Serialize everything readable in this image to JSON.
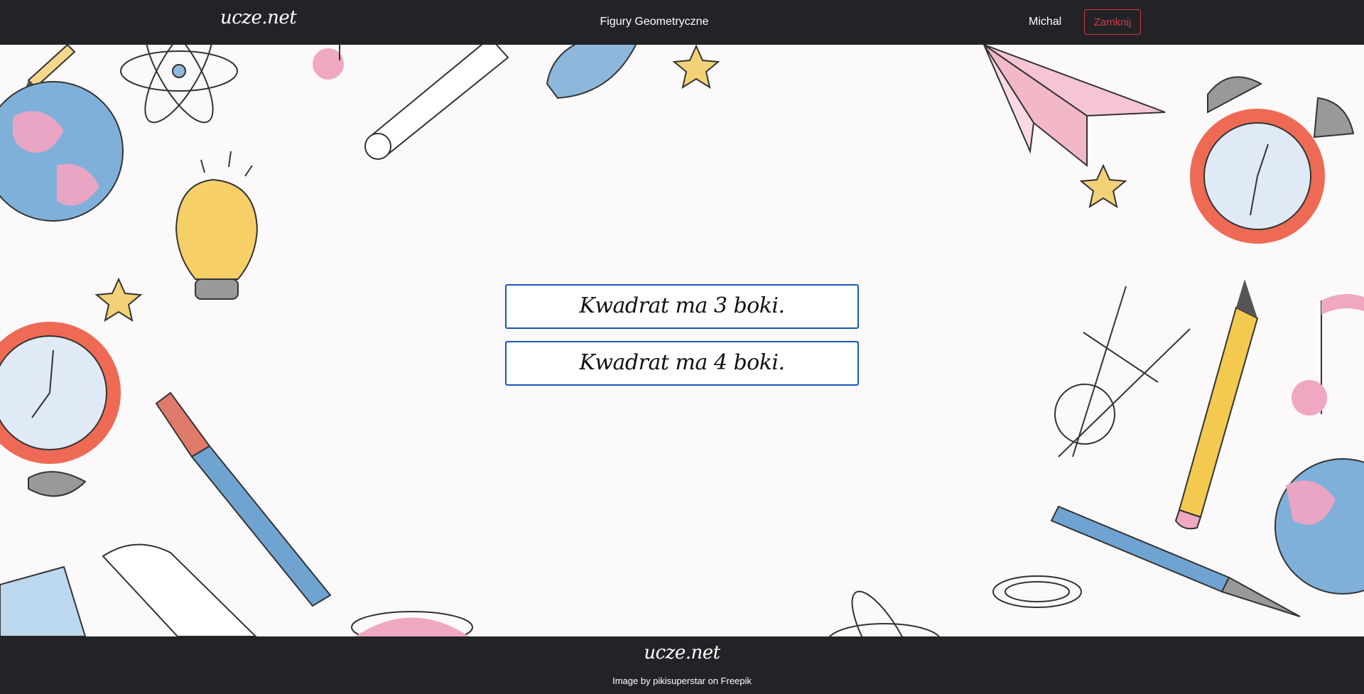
{
  "navbar": {
    "brand": "ucze.net",
    "title": "Figury Geometryczne",
    "user": "Michal",
    "close_label": "Zamknij"
  },
  "quiz": {
    "answers": [
      {
        "label": "Kwadrat ma 3 boki."
      },
      {
        "label": "Kwadrat ma 4 boki."
      }
    ],
    "answer_border_color": "#1857b6"
  },
  "footer": {
    "brand": "ucze.net",
    "credit": "Image by pikisuperstar on Freepik"
  },
  "colors": {
    "bar_bg": "#222327",
    "page_bg": "#fbf9f9",
    "danger": "#dc3545"
  },
  "background_decorations": [
    "pencil-icon",
    "atom-icon",
    "music-note-icon",
    "crayon-icon",
    "star-icon",
    "paper-plane-icon",
    "alarm-clock-icon",
    "globe-icon",
    "light-bulb-icon",
    "paintbrush-icon",
    "compass-icon",
    "eraser-icon",
    "paper-clip-icon"
  ]
}
